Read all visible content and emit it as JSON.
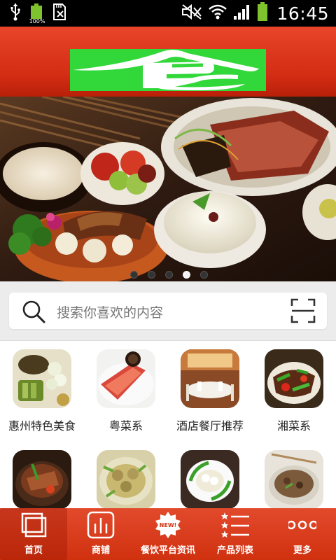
{
  "status_bar": {
    "time": "16:45",
    "battery_small_label": "100%",
    "icons": [
      "usb-icon",
      "battery-100-icon",
      "sd-card-icon",
      "mute-icon",
      "wifi-icon",
      "signal-icon",
      "battery-icon"
    ]
  },
  "header": {
    "logo_text": "食",
    "colors": {
      "header_top": "#e8452a",
      "header_bottom": "#b82008",
      "logo_bg": "#32d83a"
    }
  },
  "banner": {
    "slide_count": 5,
    "active_index": 3
  },
  "search": {
    "placeholder": "搜索你喜欢的内容",
    "left_icon": "search-icon",
    "right_icon": "scan-icon"
  },
  "categories": [
    {
      "label": "惠州特色美食"
    },
    {
      "label": "粤菜系"
    },
    {
      "label": "酒店餐厅推荐"
    },
    {
      "label": "湘菜系"
    },
    {
      "label": ""
    },
    {
      "label": ""
    },
    {
      "label": ""
    },
    {
      "label": ""
    }
  ],
  "tabs": [
    {
      "label": "首页",
      "icon": "home-window-icon",
      "active": true
    },
    {
      "label": "商铺",
      "icon": "shop-bars-icon",
      "active": false
    },
    {
      "label": "餐饮平台资讯",
      "icon": "new-badge-icon",
      "active": false,
      "badge": "NEW!"
    },
    {
      "label": "产品列表",
      "icon": "star-list-icon",
      "active": false
    },
    {
      "label": "更多",
      "icon": "more-dots-icon",
      "active": false
    }
  ]
}
